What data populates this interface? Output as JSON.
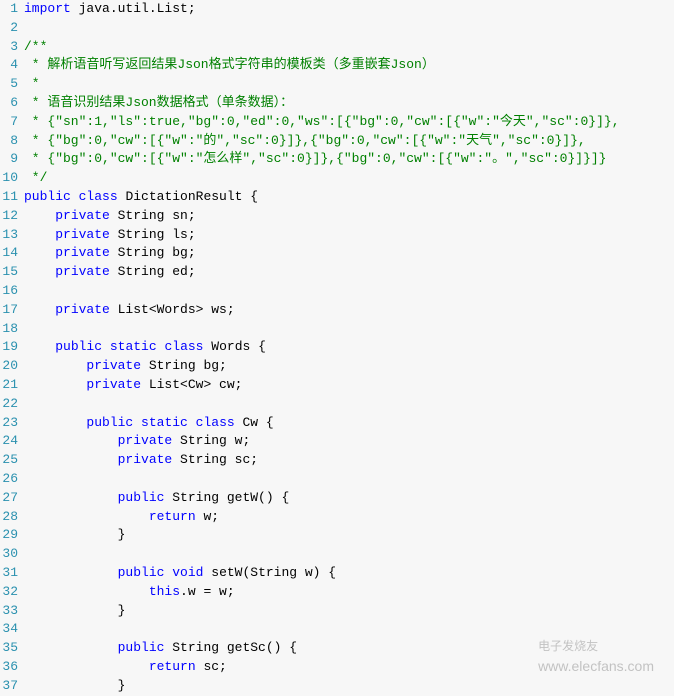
{
  "lines": [
    {
      "num": 1,
      "parts": [
        {
          "c": "kw",
          "t": "import"
        },
        {
          "c": "text",
          "t": " java.util.List;"
        }
      ]
    },
    {
      "num": 2,
      "parts": []
    },
    {
      "num": 3,
      "parts": [
        {
          "c": "comment",
          "t": "/**"
        }
      ]
    },
    {
      "num": 4,
      "parts": [
        {
          "c": "comment",
          "t": " * 解析语音听写返回结果Json格式字符串的模板类（多重嵌套Json）"
        }
      ]
    },
    {
      "num": 5,
      "parts": [
        {
          "c": "comment",
          "t": " *"
        }
      ]
    },
    {
      "num": 6,
      "parts": [
        {
          "c": "comment",
          "t": " * 语音识别结果Json数据格式（单条数据）："
        }
      ]
    },
    {
      "num": 7,
      "parts": [
        {
          "c": "comment",
          "t": " * {\"sn\":1,\"ls\":true,\"bg\":0,\"ed\":0,\"ws\":[{\"bg\":0,\"cw\":[{\"w\":\"今天\",\"sc\":0}]},"
        }
      ]
    },
    {
      "num": 8,
      "parts": [
        {
          "c": "comment",
          "t": " * {\"bg\":0,\"cw\":[{\"w\":\"的\",\"sc\":0}]},{\"bg\":0,\"cw\":[{\"w\":\"天气\",\"sc\":0}]},"
        }
      ]
    },
    {
      "num": 9,
      "parts": [
        {
          "c": "comment",
          "t": " * {\"bg\":0,\"cw\":[{\"w\":\"怎么样\",\"sc\":0}]},{\"bg\":0,\"cw\":[{\"w\":\"。\",\"sc\":0}]}]}"
        }
      ]
    },
    {
      "num": 10,
      "parts": [
        {
          "c": "comment",
          "t": " */"
        }
      ]
    },
    {
      "num": 11,
      "parts": [
        {
          "c": "kw",
          "t": "public"
        },
        {
          "c": "text",
          "t": " "
        },
        {
          "c": "kw",
          "t": "class"
        },
        {
          "c": "text",
          "t": " DictationResult {"
        }
      ]
    },
    {
      "num": 12,
      "parts": [
        {
          "c": "text",
          "t": "    "
        },
        {
          "c": "kw",
          "t": "private"
        },
        {
          "c": "text",
          "t": " String sn;"
        }
      ]
    },
    {
      "num": 13,
      "parts": [
        {
          "c": "text",
          "t": "    "
        },
        {
          "c": "kw",
          "t": "private"
        },
        {
          "c": "text",
          "t": " String ls;"
        }
      ]
    },
    {
      "num": 14,
      "parts": [
        {
          "c": "text",
          "t": "    "
        },
        {
          "c": "kw",
          "t": "private"
        },
        {
          "c": "text",
          "t": " String bg;"
        }
      ]
    },
    {
      "num": 15,
      "parts": [
        {
          "c": "text",
          "t": "    "
        },
        {
          "c": "kw",
          "t": "private"
        },
        {
          "c": "text",
          "t": " String ed;"
        }
      ]
    },
    {
      "num": 16,
      "parts": []
    },
    {
      "num": 17,
      "parts": [
        {
          "c": "text",
          "t": "    "
        },
        {
          "c": "kw",
          "t": "private"
        },
        {
          "c": "text",
          "t": " List<Words> ws;"
        }
      ]
    },
    {
      "num": 18,
      "parts": []
    },
    {
      "num": 19,
      "parts": [
        {
          "c": "text",
          "t": "    "
        },
        {
          "c": "kw",
          "t": "public"
        },
        {
          "c": "text",
          "t": " "
        },
        {
          "c": "kw",
          "t": "static"
        },
        {
          "c": "text",
          "t": " "
        },
        {
          "c": "kw",
          "t": "class"
        },
        {
          "c": "text",
          "t": " Words {"
        }
      ]
    },
    {
      "num": 20,
      "parts": [
        {
          "c": "text",
          "t": "        "
        },
        {
          "c": "kw",
          "t": "private"
        },
        {
          "c": "text",
          "t": " String bg;"
        }
      ]
    },
    {
      "num": 21,
      "parts": [
        {
          "c": "text",
          "t": "        "
        },
        {
          "c": "kw",
          "t": "private"
        },
        {
          "c": "text",
          "t": " List<Cw> cw;"
        }
      ]
    },
    {
      "num": 22,
      "parts": []
    },
    {
      "num": 23,
      "parts": [
        {
          "c": "text",
          "t": "        "
        },
        {
          "c": "kw",
          "t": "public"
        },
        {
          "c": "text",
          "t": " "
        },
        {
          "c": "kw",
          "t": "static"
        },
        {
          "c": "text",
          "t": " "
        },
        {
          "c": "kw",
          "t": "class"
        },
        {
          "c": "text",
          "t": " Cw {"
        }
      ]
    },
    {
      "num": 24,
      "parts": [
        {
          "c": "text",
          "t": "            "
        },
        {
          "c": "kw",
          "t": "private"
        },
        {
          "c": "text",
          "t": " String w;"
        }
      ]
    },
    {
      "num": 25,
      "parts": [
        {
          "c": "text",
          "t": "            "
        },
        {
          "c": "kw",
          "t": "private"
        },
        {
          "c": "text",
          "t": " String sc;"
        }
      ]
    },
    {
      "num": 26,
      "parts": []
    },
    {
      "num": 27,
      "parts": [
        {
          "c": "text",
          "t": "            "
        },
        {
          "c": "kw",
          "t": "public"
        },
        {
          "c": "text",
          "t": " String getW() {"
        }
      ]
    },
    {
      "num": 28,
      "parts": [
        {
          "c": "text",
          "t": "                "
        },
        {
          "c": "kw",
          "t": "return"
        },
        {
          "c": "text",
          "t": " w;"
        }
      ]
    },
    {
      "num": 29,
      "parts": [
        {
          "c": "text",
          "t": "            }"
        }
      ]
    },
    {
      "num": 30,
      "parts": []
    },
    {
      "num": 31,
      "parts": [
        {
          "c": "text",
          "t": "            "
        },
        {
          "c": "kw",
          "t": "public"
        },
        {
          "c": "text",
          "t": " "
        },
        {
          "c": "kw",
          "t": "void"
        },
        {
          "c": "text",
          "t": " setW(String w) {"
        }
      ]
    },
    {
      "num": 32,
      "parts": [
        {
          "c": "text",
          "t": "                "
        },
        {
          "c": "kw",
          "t": "this"
        },
        {
          "c": "text",
          "t": ".w = w;"
        }
      ]
    },
    {
      "num": 33,
      "parts": [
        {
          "c": "text",
          "t": "            }"
        }
      ]
    },
    {
      "num": 34,
      "parts": []
    },
    {
      "num": 35,
      "parts": [
        {
          "c": "text",
          "t": "            "
        },
        {
          "c": "kw",
          "t": "public"
        },
        {
          "c": "text",
          "t": " String getSc() {"
        }
      ]
    },
    {
      "num": 36,
      "parts": [
        {
          "c": "text",
          "t": "                "
        },
        {
          "c": "kw",
          "t": "return"
        },
        {
          "c": "text",
          "t": " sc;"
        }
      ]
    },
    {
      "num": 37,
      "parts": [
        {
          "c": "text",
          "t": "            }"
        }
      ]
    }
  ],
  "watermark": {
    "cn": "电子发烧友",
    "url": "www.elecfans.com"
  }
}
